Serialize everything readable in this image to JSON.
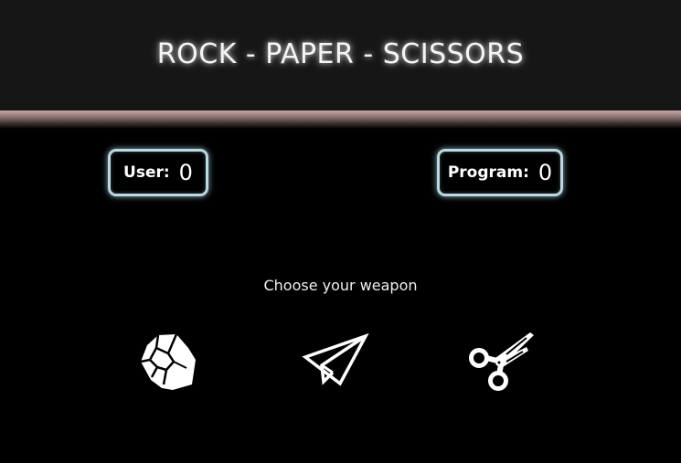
{
  "header": {
    "title": "ROCK - PAPER - SCISSORS"
  },
  "scoreboard": {
    "user": {
      "label": "User:",
      "value": "0"
    },
    "program": {
      "label": "Program:",
      "value": "0"
    }
  },
  "game": {
    "prompt": "Choose your weapon",
    "weapons": [
      {
        "id": "rock",
        "icon": "rock-icon"
      },
      {
        "id": "paper",
        "icon": "paper-plane-icon"
      },
      {
        "id": "scissors",
        "icon": "scissors-icon"
      }
    ]
  },
  "colors": {
    "background": "#000000",
    "header_background": "#161616",
    "header_bar": "#c4a8a6",
    "score_border_glow": "#bcd9e1",
    "text": "#ffffff"
  }
}
